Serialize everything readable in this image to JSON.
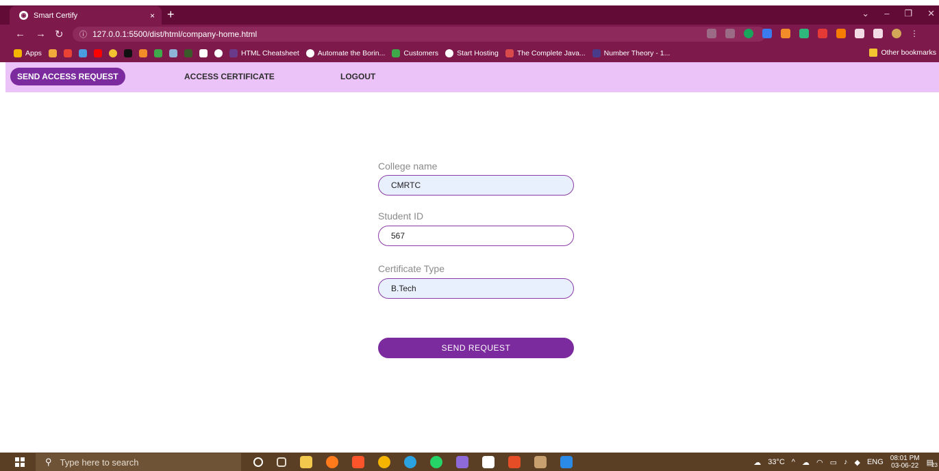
{
  "browser": {
    "tab_title": "Smart Certify",
    "tab_close": "×",
    "new_tab": "+",
    "url": "127.0.0.1:5500/dist/html/company-home.html",
    "bookmarks": [
      {
        "label": "Apps",
        "color": "#f4b400"
      },
      {
        "label": "HTML Cheatsheet",
        "color": "#6a3b8a"
      },
      {
        "label": "Automate the Borin...",
        "color": "#ffffff"
      },
      {
        "label": "Customers",
        "color": "#3ea84a"
      },
      {
        "label": "Start Hosting",
        "color": "#ffffff"
      },
      {
        "label": "The Complete Java...",
        "color": "#d94a4a"
      },
      {
        "label": "Number Theory - 1...",
        "color": "#4a3b8a"
      }
    ],
    "other_bookmarks": "Other bookmarks"
  },
  "navbar": {
    "send_access_request": "SEND ACCESS REQUEST",
    "access_certificate": "ACCESS CERTIFICATE",
    "logout": "LOGOUT"
  },
  "form": {
    "college_label": "College name",
    "college_value": "CMRTC",
    "student_id_label": "Student ID",
    "student_id_value": "567",
    "cert_type_label": "Certificate Type",
    "cert_type_value": "B.Tech",
    "submit_label": "SEND REQUEST"
  },
  "taskbar": {
    "search_placeholder": "Type here to search",
    "temperature": "33°C",
    "language": "ENG",
    "time": "08:01 PM",
    "date": "03-06-22",
    "notification_count": "23"
  },
  "colors": {
    "accent": "#7b2b9d",
    "navbar_bg": "#ebc3f9",
    "browser_frame": "#7d1a4b"
  }
}
